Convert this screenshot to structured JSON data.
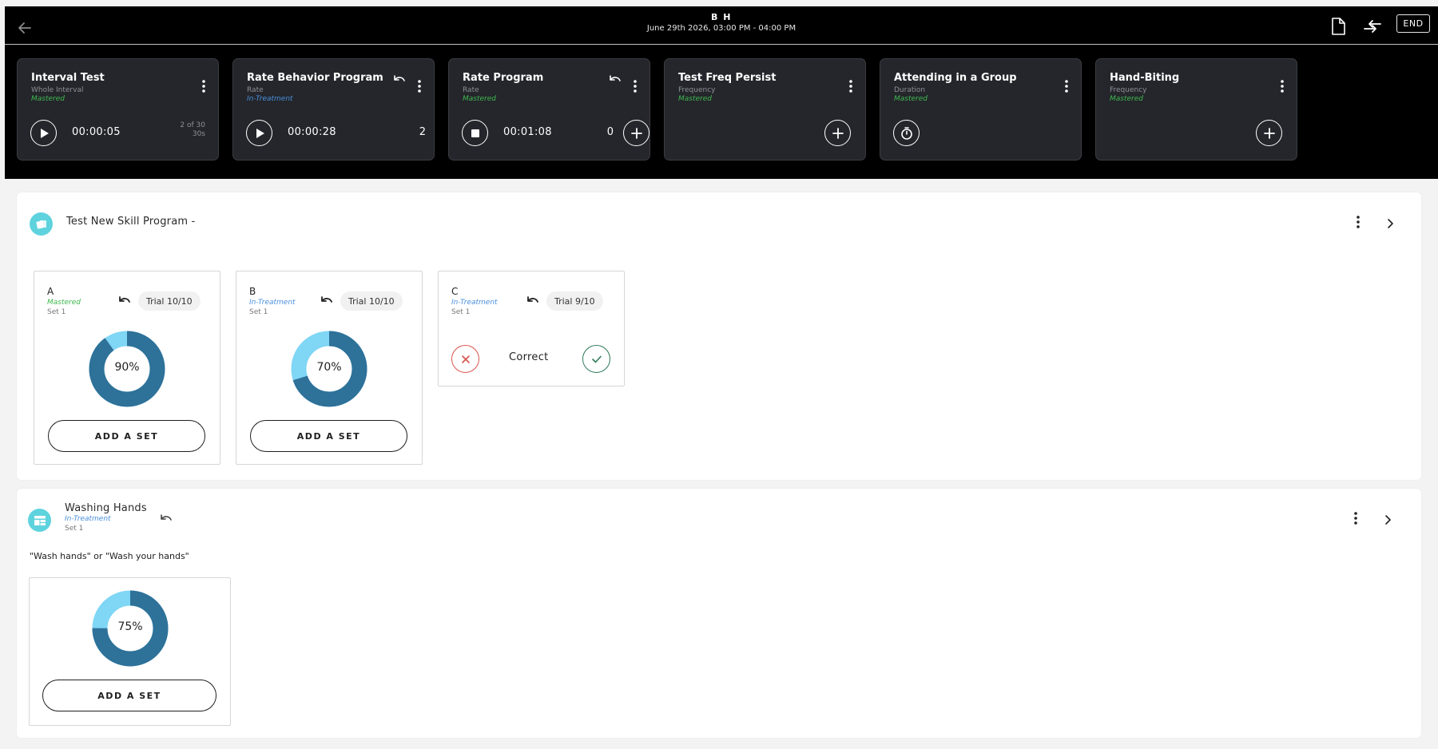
{
  "header": {
    "client_name": "B H",
    "session_time": "June 29th 2026, 03:00 PM - 04:00 PM",
    "end_label": "END"
  },
  "behaviors": [
    {
      "title": "Interval Test",
      "type": "Whole Interval",
      "status": "Mastered",
      "timer": "00:00:05",
      "sub_line1": "2 of 30",
      "sub_line2": "30s"
    },
    {
      "title": "Rate Behavior Program",
      "type": "Rate",
      "status": "In-Treatment",
      "timer": "00:00:28",
      "count": "2"
    },
    {
      "title": "Rate Program",
      "type": "Rate",
      "status": "Mastered",
      "timer": "00:01:08",
      "count": "0"
    },
    {
      "title": "Test Freq Persist",
      "type": "Frequency",
      "status": "Mastered"
    },
    {
      "title": "Attending in a Group",
      "type": "Duration",
      "status": "Mastered"
    },
    {
      "title": "Hand-Biting",
      "type": "Frequency",
      "status": "Mastered"
    }
  ],
  "programs": [
    {
      "title": "Test New Skill Program -",
      "targets": [
        {
          "name": "A",
          "status": "Mastered",
          "set": "Set 1",
          "trial": "Trial 10/10",
          "percent_label": "90%",
          "percent": 90,
          "add_set_label": "ADD A SET"
        },
        {
          "name": "B",
          "status": "In-Treatment",
          "set": "Set 1",
          "trial": "Trial 10/10",
          "percent_label": "70%",
          "percent": 70,
          "add_set_label": "ADD A SET"
        },
        {
          "name": "C",
          "status": "In-Treatment",
          "set": "Set 1",
          "trial": "Trial 9/10",
          "correct_label": "Correct"
        }
      ]
    },
    {
      "title": "Washing Hands",
      "status": "In-Treatment",
      "set": "Set 1",
      "sd": "\"Wash hands\" or \"Wash your hands\"",
      "target": {
        "percent_label": "75%",
        "percent": 75,
        "add_set_label": "ADD A SET"
      }
    }
  ],
  "colors": {
    "donut_dark": "#2e7199",
    "donut_light": "#7fd6f5",
    "mastered": "#3fb84f",
    "in_treatment": "#4a8fdc",
    "incorrect": "#d9534f",
    "correct": "#2f7a5a",
    "icon_teal": "#5ed3de"
  },
  "icons": {
    "back": "arrow-left-icon",
    "notes": "document-icon",
    "switch": "swap-arrows-icon",
    "play": "play-icon",
    "stop": "stop-icon",
    "add": "plus-icon",
    "timer": "stopwatch-icon",
    "undo": "undo-icon",
    "menu": "vertical-dots-icon",
    "expand": "chevron-right-icon"
  }
}
